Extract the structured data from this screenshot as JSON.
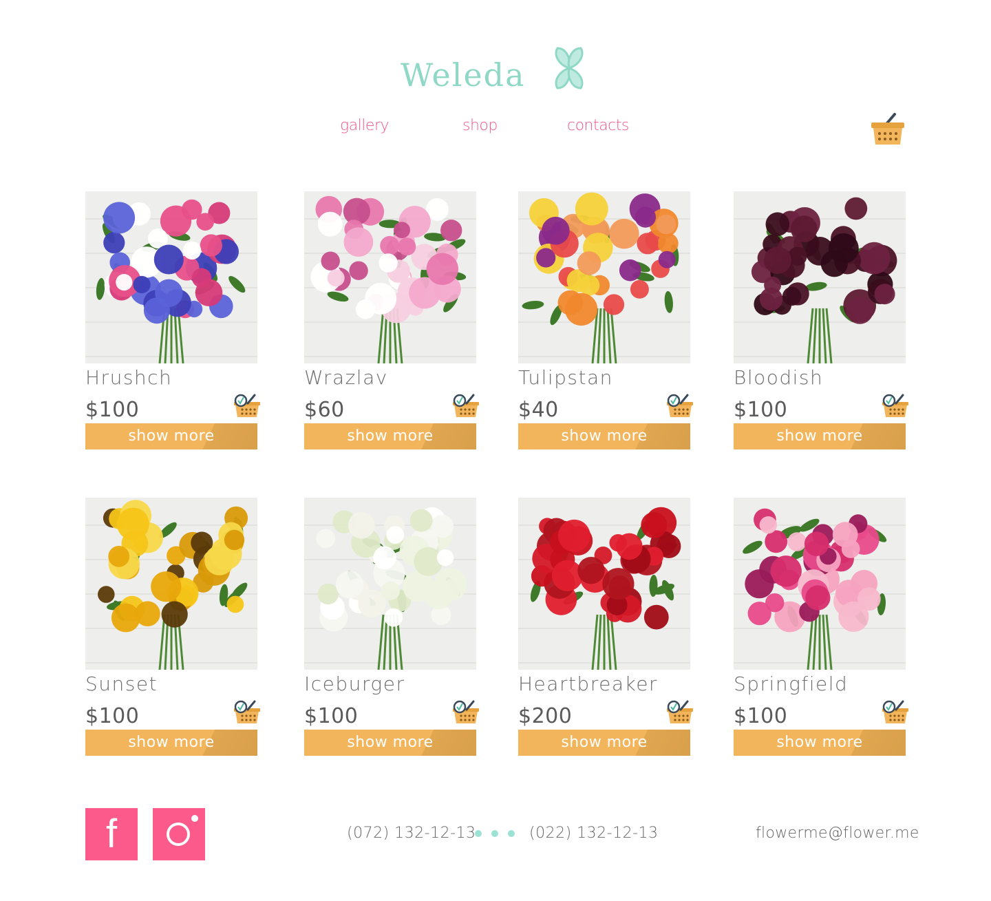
{
  "brand": {
    "name": "Weleda",
    "color": "#8fd8c6"
  },
  "nav": [
    {
      "label": "gallery"
    },
    {
      "label": "shop"
    },
    {
      "label": "contacts"
    }
  ],
  "colors": {
    "accent": "#f0588a",
    "button": "#f2b55c",
    "social": "#fc5a8a",
    "dots": "#9de3d5"
  },
  "products": [
    {
      "name": "Hrushch",
      "price": "$100",
      "button": "show more",
      "icon": "add-to-cart-icon"
    },
    {
      "name": "Wrazlav",
      "price": "$60",
      "button": "show more",
      "icon": "add-to-cart-icon"
    },
    {
      "name": "Tulipstan",
      "price": "$40",
      "button": "show more",
      "icon": "add-to-cart-icon"
    },
    {
      "name": "Bloodish",
      "price": "$100",
      "button": "show more",
      "icon": "add-to-cart-icon"
    },
    {
      "name": "Sunset",
      "price": "$100",
      "button": "show more",
      "icon": "add-to-cart-icon"
    },
    {
      "name": "Iceburger",
      "price": "$100",
      "button": "show more",
      "icon": "add-to-cart-icon"
    },
    {
      "name": "Heartbreaker",
      "price": "$200",
      "button": "show more",
      "icon": "add-to-cart-icon"
    },
    {
      "name": "Springfield",
      "price": "$100",
      "button": "show more",
      "icon": "add-to-cart-icon"
    }
  ],
  "footer": {
    "phone_1": "(072) 132-12-13",
    "phone_2": "(022) 132-12-13",
    "email": "flowerme@flower.me",
    "facebook_glyph": "f"
  }
}
